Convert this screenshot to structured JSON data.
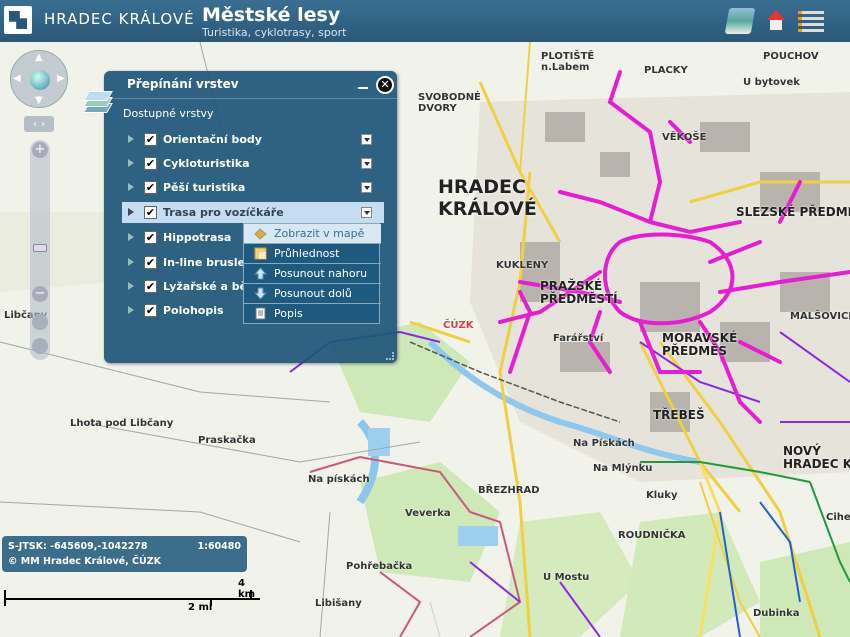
{
  "header": {
    "city_name": "HRADEC KRÁLOVÉ",
    "title": "Městské lesy",
    "subtitle": "Turistika, cyklotrasy, sport",
    "icons": [
      "layers-icon",
      "home-icon",
      "legend-icon"
    ]
  },
  "map": {
    "labels": {
      "hk1": "HRADEC",
      "hk2": "KRÁLOVÉ",
      "plotiste1": "PLOTIŠTĚ",
      "plotiste2": "n.Labem",
      "placky": "PLACKY",
      "pouchov": "POUCHOV",
      "svobodne1": "SVOBODNÉ",
      "svobodne2": "DVORY",
      "vekose": "VĚKOŠE",
      "slezske": "SLEZSKÉ PŘEDMĚS",
      "kukleny": "KUKLENY",
      "prazske1": "PRAŽSKÉ",
      "prazske2": "PŘEDMĚSTÍ",
      "fararstvi": "Farářství",
      "malsovice": "MALŠOVICE",
      "moravske1": "MORAVSKÉ",
      "moravske2": "PŘEDMĚS",
      "trebes": "TŘEBEŠ",
      "novy1": "NOVÝ",
      "novy2": "HRADEC KRÁL",
      "brezhrad": "BŘEZHRAD",
      "roudnicka": "ROUDNIČKA",
      "libcany": "Libčany",
      "lhota": "Lhota pod Libčany",
      "praskacka": "Praskačka",
      "pohrebacka": "Pohřebačka",
      "libisany": "Libišany",
      "veverka": "Veverka",
      "napiskach": "Na Pískách",
      "napiskach2": "Na pískách",
      "namlynku": "Na Mlýnku",
      "kluky": "Kluky",
      "umostu": "U Mostu",
      "dubinka": "Dubinka",
      "cuzk": "ČÚZK",
      "cihelna": "Cihelna",
      "ubytovek": "U bytovek"
    }
  },
  "layer_panel": {
    "title": "Přepínání vrstev",
    "subtitle": "Dostupné vrstvy",
    "layers": [
      {
        "label": "Orientační body",
        "checked": "✔"
      },
      {
        "label": "Cykloturistika",
        "checked": "✔"
      },
      {
        "label": "Pěší turistika",
        "checked": "✔"
      },
      {
        "label": "Trasa pro vozíčkáře",
        "checked": "✔"
      },
      {
        "label": "Hippotrasa",
        "checked": "✔"
      },
      {
        "label": "In-line bruslení",
        "checked": "✔"
      },
      {
        "label": "Lyžařské a běžecké trasy",
        "checked": "✔"
      },
      {
        "label": "Polohopis",
        "checked": "✔"
      }
    ],
    "active_layer_index": 3
  },
  "context_menu": {
    "items": [
      {
        "label": "Zobrazit v mapě",
        "icon": "zoom-to-map-icon"
      },
      {
        "label": "Průhlednost",
        "icon": "transparency-icon"
      },
      {
        "label": "Posunout nahoru",
        "icon": "arrow-up-icon"
      },
      {
        "label": "Posunout dolů",
        "icon": "arrow-down-icon"
      },
      {
        "label": "Popis",
        "icon": "document-icon"
      }
    ],
    "highlighted_index": 0
  },
  "status": {
    "coordinates": "S-JTSK: -645609,-1042278",
    "scale": "1:60480",
    "copyright": "© MM Hradec Králové, ČÚZK"
  },
  "scalebar": {
    "km_label": "4 km",
    "mi_label": "2 mi"
  },
  "colors": {
    "header": "#2b5878",
    "panel": "#1e5578",
    "wheelchair_route": "#e61ed2",
    "cycle_route": "#8a2be2",
    "road_yellow": "#f0d040",
    "forest": "#cfe8b8"
  }
}
